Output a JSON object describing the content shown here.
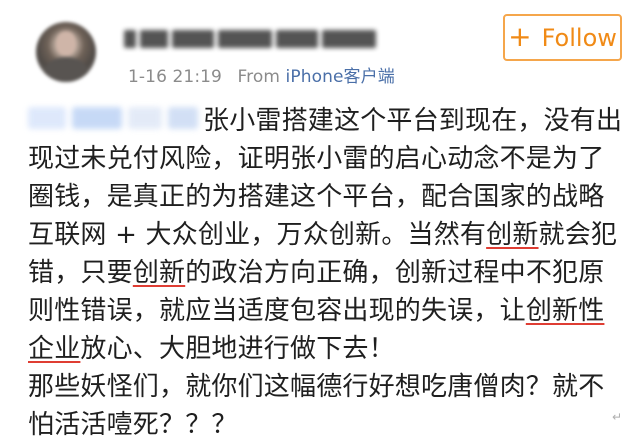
{
  "header": {
    "time": "1-16 21:19",
    "source_prefix": "From ",
    "source_link": "iPhone客户端",
    "follow_plus": "+",
    "follow_label": "Follow"
  },
  "post": {
    "line1": "张小雷搭建这个平台到现在，没有出",
    "line2": "现过未兑付风险，证明张小雷的启心动念不是为了",
    "line3": "圈钱，是真正的为搭建这个平台，配合国家的战略",
    "line4_prefix": "互联网 + 大众创业，万众创新。当然有",
    "line4_highlight": "创新",
    "line4_suffix": "就会犯",
    "line5_prefix": "错，只要",
    "line5_highlight": "创新",
    "line5_suffix": "的政治方向正确，创新过程中不犯原",
    "line6_prefix": "则性错误，就应当适度包容出现的失误，让",
    "line6_highlight": "创新性",
    "line7_highlight": "企业",
    "line7_suffix": "放心、大胆地进行做下去！",
    "line8": "那些妖怪们，就你们这幅德行好想吃唐僧肉？就不",
    "line9": "怕活活噎死？？？"
  },
  "footer": {
    "mark": "↵"
  },
  "colors": {
    "follow_border": "#f5a64b",
    "follow_text": "#f08a16",
    "meta_text": "#8b8b8b",
    "source_link": "#4a6fa8",
    "underline": "#df3d33"
  },
  "icons": {
    "avatar": "blurred-user-avatar",
    "follow_plus": "plus-icon"
  }
}
